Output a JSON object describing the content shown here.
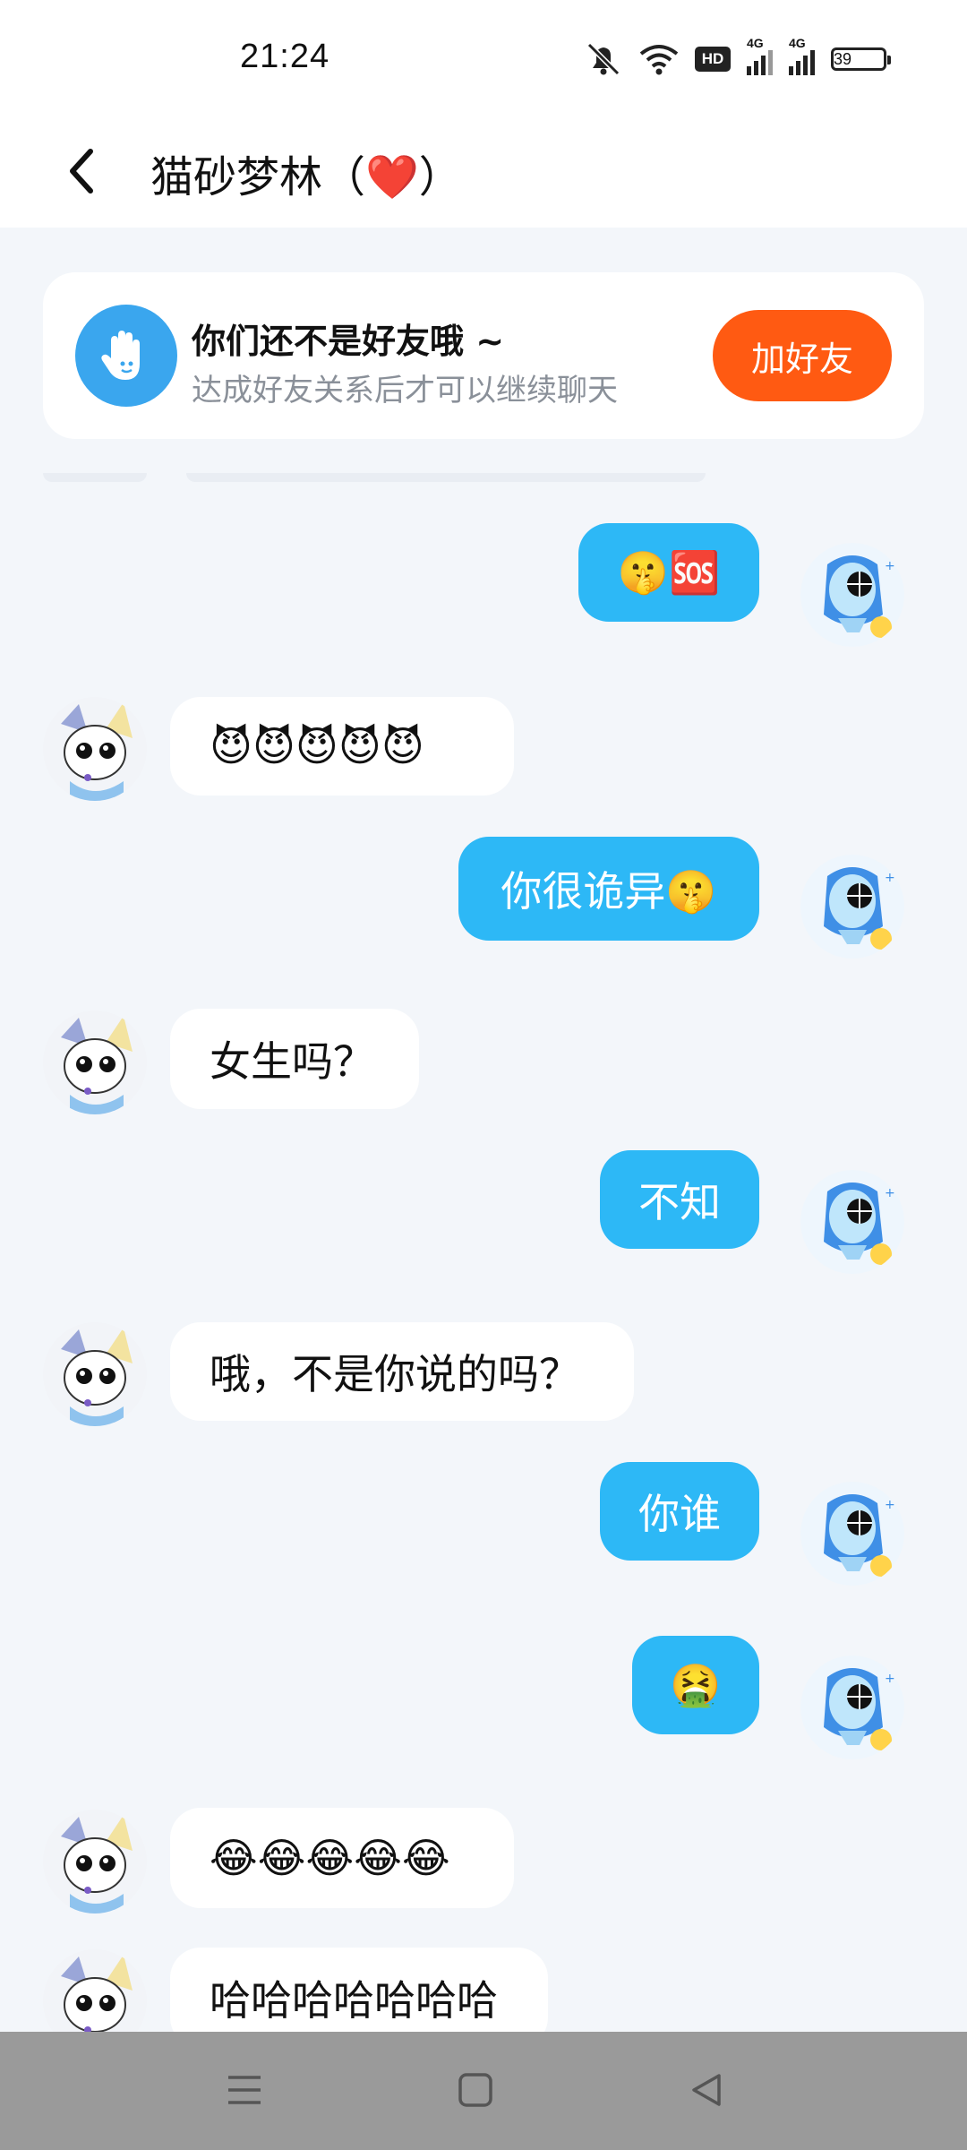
{
  "status_bar": {
    "time": "21:24",
    "battery": "39",
    "network_labels": [
      "4G",
      "4G"
    ],
    "hd_label": "HD"
  },
  "header": {
    "title_prefix": "猫砂梦林（",
    "title_heart": "❤️",
    "title_suffix": "）"
  },
  "friend_prompt": {
    "title": "你们还不是好友哦 ~",
    "subtitle": "达成好友关系后才可以继续聊天",
    "button_label": "加好友"
  },
  "messages": [
    {
      "side": "out",
      "text": "🤫🆘"
    },
    {
      "side": "in",
      "text": "😈😈😈😈😈"
    },
    {
      "side": "out",
      "text": "你很诡异🤫"
    },
    {
      "side": "in",
      "text": "女生吗？"
    },
    {
      "side": "out",
      "text": "不知"
    },
    {
      "side": "in",
      "text": "哦，不是你说的吗？"
    },
    {
      "side": "out",
      "text": "你谁"
    },
    {
      "side": "out",
      "text": "🤮"
    },
    {
      "side": "in",
      "text": "😂😂😂😂😂"
    },
    {
      "side": "in",
      "text": "哈哈哈哈哈哈哈"
    }
  ],
  "colors": {
    "accent": "#2db8f6",
    "add_button": "#ff5a12",
    "background": "#f3f6fa"
  },
  "icons": {
    "back": "chevron-left-icon",
    "hand": "wave-hand-icon",
    "nav": [
      "menu-icon",
      "home-square-icon",
      "back-triangle-icon"
    ]
  }
}
